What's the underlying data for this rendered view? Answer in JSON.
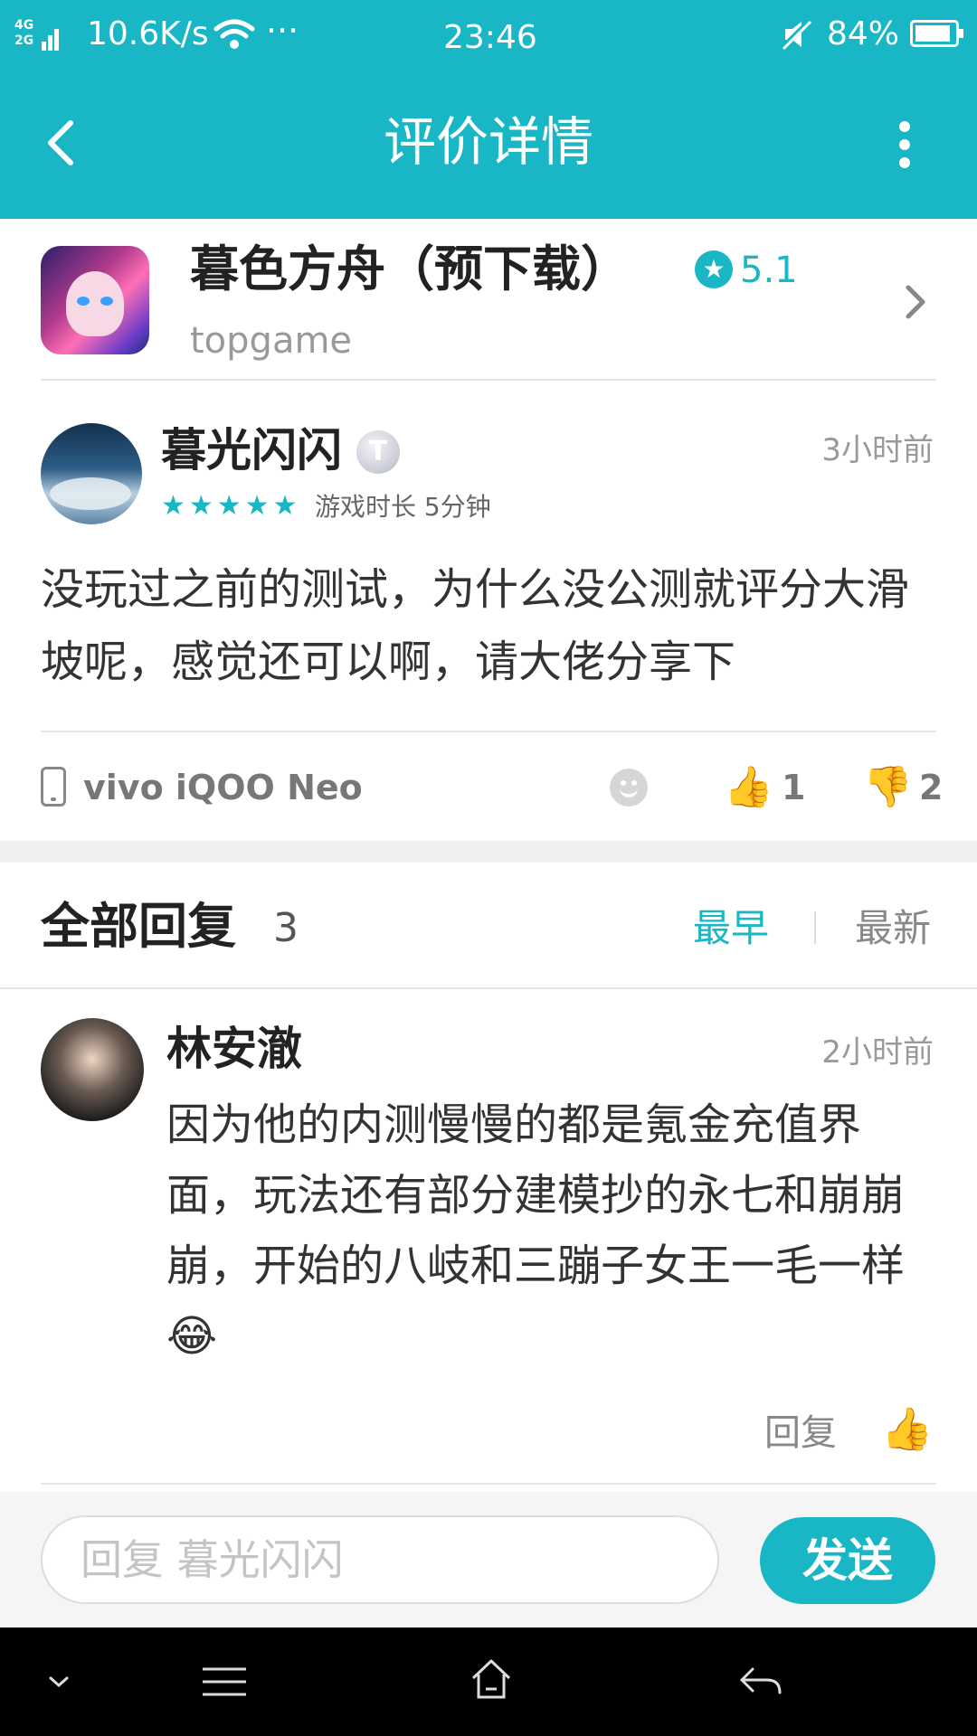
{
  "status_bar": {
    "network_label": "4G 2G",
    "speed": "10.6K/s",
    "more": "···",
    "time": "23:46",
    "battery": "84%"
  },
  "header": {
    "title": "评价详情"
  },
  "app": {
    "name": "暮色方舟（预下载）",
    "developer": "topgame",
    "rating": "5.1"
  },
  "review": {
    "username": "暮光闪闪",
    "level_badge": "T",
    "stars": "★★★★★",
    "play_time": "游戏时长 5分钟",
    "time_ago": "3小时前",
    "content": "没玩过之前的测试，为什么没公测就评分大滑坡呢，感觉还可以啊，请大佬分享下",
    "device": "vivo iQOO Neo",
    "likes": "1",
    "dislikes": "2"
  },
  "replies": {
    "title": "全部回复",
    "count": "3",
    "sort_earliest": "最早",
    "sort_latest": "最新",
    "items": [
      {
        "username": "林安澈",
        "time_ago": "2小时前",
        "content": "因为他的内测慢慢的都是氪金充值界面，玩法还有部分建模抄的永七和崩崩崩，开始的八岐和三蹦子女王一毛一样😂",
        "action_label": "回复"
      }
    ]
  },
  "reply_box": {
    "placeholder": "回复 暮光闪闪",
    "send_label": "发送"
  },
  "colors": {
    "accent": "#19b7c6"
  }
}
